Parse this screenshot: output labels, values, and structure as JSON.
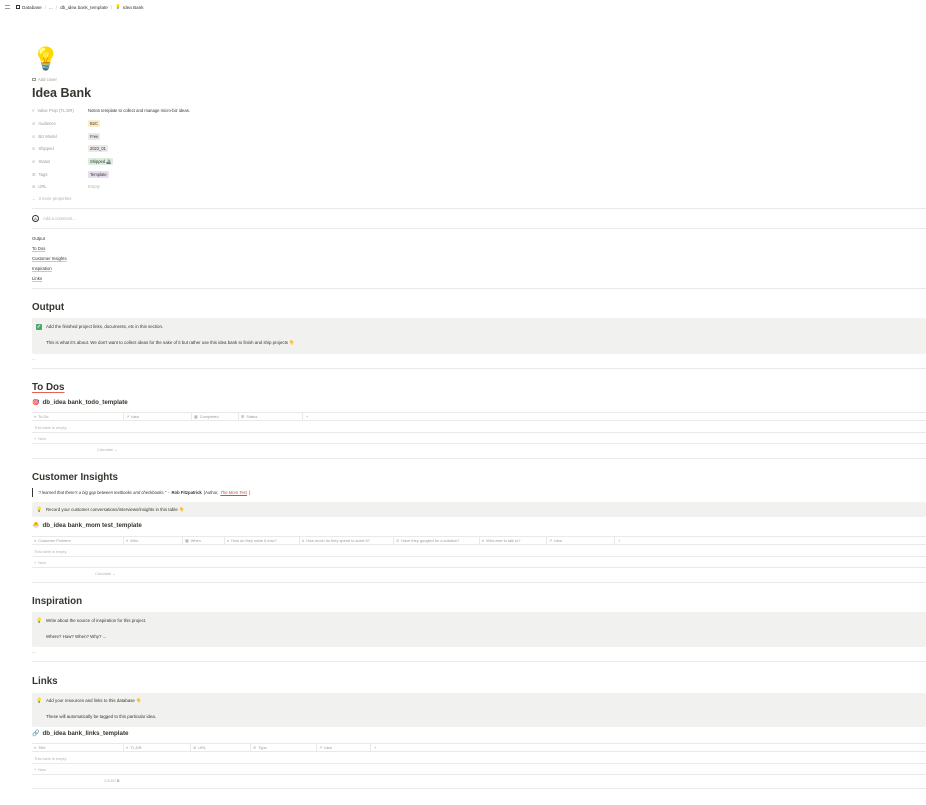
{
  "breadcrumb": {
    "items": [
      {
        "icon": "table-icon",
        "label": "Database"
      },
      {
        "icon": "",
        "label": "..."
      },
      {
        "icon": "",
        "label": "db_idea bank_template"
      },
      {
        "icon": "lightbulb-icon",
        "label": "Idea Bank"
      }
    ]
  },
  "page": {
    "icon": "💡",
    "add_cover": "Add cover",
    "title": "Idea Bank"
  },
  "properties": [
    {
      "name": "Value Prop (TL;DR)",
      "icon": "text-icon",
      "value": "Notion template to collect and manage micro-biz ideas.",
      "pill": false,
      "color": ""
    },
    {
      "name": "Audience",
      "icon": "select-icon",
      "value": "B2C",
      "pill": true,
      "color": "#fdecc8"
    },
    {
      "name": "Biz Model",
      "icon": "select-icon",
      "value": "Free",
      "pill": true,
      "color": "#e9e9e7"
    },
    {
      "name": "Shipped",
      "icon": "select-icon",
      "value": "2022_01",
      "pill": true,
      "color": "#e9e9e7"
    },
    {
      "name": "Status",
      "icon": "select-icon",
      "value": "Shipped 🚢",
      "pill": true,
      "color": "#dbeddb"
    },
    {
      "name": "Tags",
      "icon": "multiselect-icon",
      "value": "Template",
      "pill": true,
      "color": "#e8deee"
    },
    {
      "name": "URL",
      "icon": "link-icon",
      "value": "Empty",
      "pill": false,
      "color": "#b5b3ad"
    }
  ],
  "more_properties": "3 more properties",
  "comment_placeholder": "Add a comment...",
  "toc": [
    "Output",
    "To Dos",
    "Customer Insights",
    "Inspiration",
    "Links"
  ],
  "sections": {
    "output": {
      "heading": "Output",
      "callout_line1": "Add the finished project links, documents, etc in this section.",
      "callout_line2": "This is what it's about. We don't want to collect ideas for the sake of it but rather use this idea bank to finish and ship projects 👇",
      "dots": "..."
    },
    "todos": {
      "heading": "To Dos",
      "db_title": "db_idea bank_todo_template",
      "columns": [
        "To Do",
        "Idea",
        "Completed",
        "Status",
        "+"
      ],
      "empty": "This table is empty.",
      "new": "New",
      "calculate": "Calculate"
    },
    "insights": {
      "heading": "Customer Insights",
      "quote_text": "\"I learned that there's a big gap between textbooks and checkbooks.\"",
      "quote_dash": " - ",
      "quote_author": "Rob Fitzpatrick",
      "quote_role": "(Author,",
      "quote_book": "The Mom Test",
      "quote_close": ")",
      "callout": "Record your customer conversations/interviews/insights in this table 👇",
      "db_title": "db_idea bank_mom test_template",
      "columns": [
        "Customer Problem",
        "Who",
        "When",
        "How do they solve it now?",
        "How much do they spend to solve it?",
        "Have they googled for a solution?",
        "Who else to talk to?",
        "Idea",
        "+"
      ],
      "empty": "This table is empty.",
      "new": "New",
      "calculate": "Calculate"
    },
    "inspiration": {
      "heading": "Inspiration",
      "callout_line1": "Write about the source of inspiration for this project.",
      "callout_line2": "Where? How? When? Why? ...",
      "dots": "..."
    },
    "links": {
      "heading": "Links",
      "callout_line1": "Add your resources and links to this database 👇",
      "callout_line2": "These will automatically be tagged to this particular idea.",
      "db_title": "db_idea bank_links_template",
      "columns": [
        "Title",
        "TL;DR",
        "URL",
        "Type",
        "Idea",
        "+"
      ],
      "empty": "This table is empty.",
      "new": "New",
      "count_label": "COUNT",
      "count_value": "0"
    }
  }
}
